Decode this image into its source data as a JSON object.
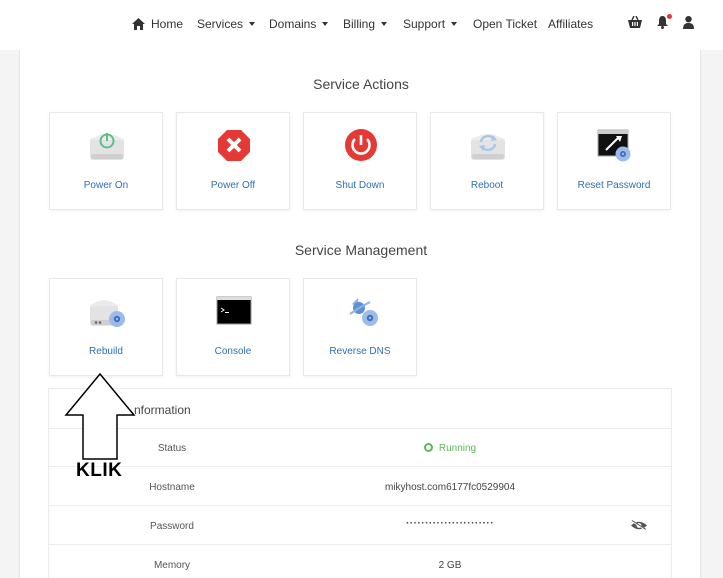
{
  "nav": {
    "items": [
      {
        "label": "Home",
        "icon": "home-icon",
        "dropdown": false
      },
      {
        "label": "Services",
        "dropdown": true
      },
      {
        "label": "Domains",
        "dropdown": true
      },
      {
        "label": "Billing",
        "dropdown": true
      },
      {
        "label": "Support",
        "dropdown": true
      },
      {
        "label": "Open Ticket",
        "dropdown": false
      },
      {
        "label": "Affiliates",
        "dropdown": false
      }
    ],
    "right_icons": [
      "cart-icon",
      "bell-icon",
      "user-icon"
    ]
  },
  "service_actions": {
    "title": "Service Actions",
    "cards": [
      {
        "label": "Power On",
        "icon": "power-on-icon"
      },
      {
        "label": "Power Off",
        "icon": "power-off-icon"
      },
      {
        "label": "Shut Down",
        "icon": "shutdown-icon"
      },
      {
        "label": "Reboot",
        "icon": "reboot-icon"
      },
      {
        "label": "Reset Password",
        "icon": "reset-password-icon"
      }
    ]
  },
  "service_management": {
    "title": "Service Management",
    "cards": [
      {
        "label": "Rebuild",
        "icon": "rebuild-icon"
      },
      {
        "label": "Console",
        "icon": "console-icon"
      },
      {
        "label": "Reverse DNS",
        "icon": "reverse-dns-icon"
      }
    ]
  },
  "info": {
    "title_visible": "nformation",
    "rows": [
      {
        "label": "Status",
        "value": "Running"
      },
      {
        "label": "Hostname",
        "value": "mikyhost.com6177fc0529904"
      },
      {
        "label": "Password",
        "value": "·······················"
      },
      {
        "label": "Memory",
        "value": "2 GB"
      }
    ]
  },
  "overlay": {
    "text": "KLIK"
  },
  "colors": {
    "link": "#2f6fb3",
    "running": "#5cb85c",
    "danger": "#e53935"
  }
}
